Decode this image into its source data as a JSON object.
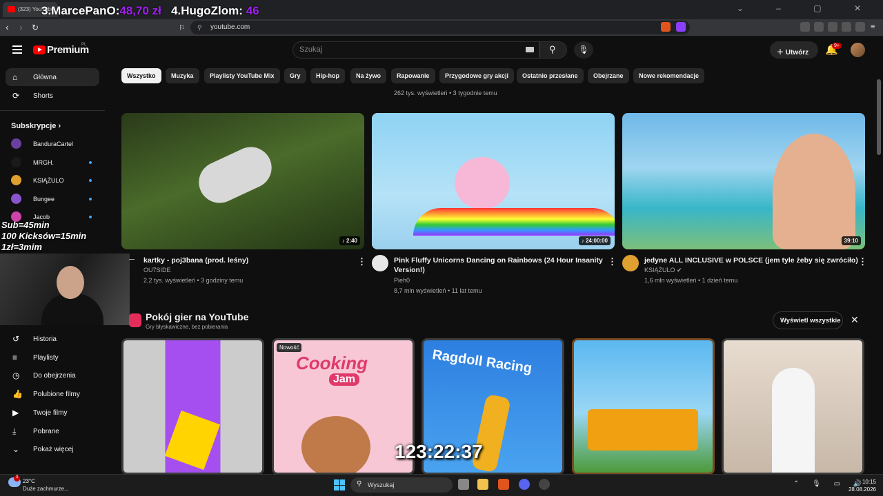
{
  "browser": {
    "tab_title": "(323) YouTube",
    "url": "youtube.com"
  },
  "stream_overlay": {
    "leaderboard_3_name": "3.MarcePanO:",
    "leaderboard_3_value": "48,70 zł",
    "leaderboard_4_name": "4.HugoZlom:",
    "leaderboard_4_value": "46",
    "rules_line1": "Sub=45min",
    "rules_line2": "100 Kicksów=15min",
    "rules_line3": "1zł=3mim",
    "timer": "123:22:37"
  },
  "header": {
    "logo": "Premium",
    "logo_region": "PL",
    "search_placeholder": "Szukaj",
    "create_label": "Utwórz",
    "notifications_badge": "9+"
  },
  "chips": [
    "Wszystko",
    "Muzyka",
    "Playlisty YouTube Mix",
    "Gry",
    "Hip-hop",
    "Na żywo",
    "Rapowanie",
    "Przygodowe gry akcji",
    "Ostatnio przesłane",
    "Obejrzane",
    "Nowe rekomendacje"
  ],
  "sidebar": {
    "home": "Główna",
    "shorts": "Shorts",
    "subscriptions_header": "Subskrypcje",
    "subscriptions": [
      {
        "name": "BanduraCartel",
        "new": false,
        "color": "#6a3fa0"
      },
      {
        "name": "MRGH.",
        "new": true,
        "color": "#1a1a1a"
      },
      {
        "name": "KSIĄŻULO",
        "new": true,
        "color": "#e0a030"
      },
      {
        "name": "Bungee",
        "new": true,
        "color": "#8855cc"
      },
      {
        "name": "Jacob",
        "new": true,
        "color": "#cc44aa"
      }
    ],
    "you_items": [
      "Historia",
      "Playlisty",
      "Do obejrzenia",
      "Polubione filmy",
      "Twoje filmy",
      "Pobrane",
      "Pokaż więcej"
    ]
  },
  "prev_row_meta": "262 tys. wyświetleń • 3 tygodnie temu",
  "videos": [
    {
      "title_line1": "kartky - poj3bana (prod. leśny)",
      "title_line2": "",
      "channel": "OU7SIDE",
      "meta": "2,2 tys. wyświetleń • 3 godziny temu",
      "duration": "♪ 2:40"
    },
    {
      "title_line1": "Pink Fluffy Unicorns Dancing on Rainbows (24 Hour Insanity",
      "title_line2": "Version!)",
      "channel": "Pieh0",
      "meta": "8,7 mln wyświetleń • 11 lat temu",
      "duration": "♪ 24:00:00"
    },
    {
      "title_line1": "jedyne ALL INCLUSIVE w POLSCE (jem tyle żeby się zwróciło)",
      "title_line2": "",
      "channel": "KSIĄŻULO",
      "meta": "1,6 mln wyświetleń • 1 dzień temu",
      "duration": "39:10"
    }
  ],
  "games": {
    "title": "Pokój gier na YouTube",
    "subtitle": "Gry błyskawiczne, bez pobierania",
    "show_all": "Wyświetl wszystkie",
    "new_badge": "Nowość",
    "game2_title_a": "Cooking",
    "game2_title_b": "Jam",
    "game3_title": "Ragdoll Racing"
  },
  "taskbar": {
    "temperature": "23°C",
    "weather": "Duże zachmurze...",
    "search": "Wyszukaj",
    "time": "10:15",
    "date": "28.08.2026",
    "weather_badge": "3"
  }
}
